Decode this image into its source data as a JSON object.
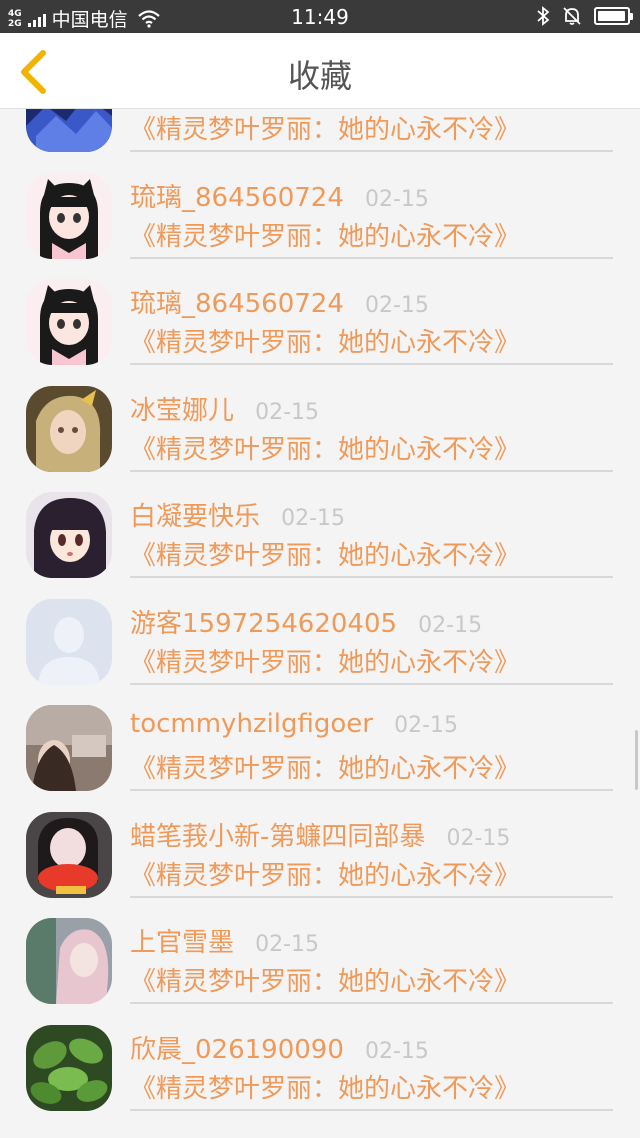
{
  "status_bar": {
    "network_top": "4G",
    "network_bottom": "2G",
    "carrier": "中国电信",
    "time": "11:49",
    "battery_level": 0.95,
    "icons": [
      "signal-icon",
      "wifi-icon",
      "bluetooth-icon",
      "silent-bell-icon",
      "battery-icon"
    ]
  },
  "header": {
    "title": "收藏",
    "back_icon": "chevron-left-icon",
    "accent_color": "#f0b400"
  },
  "colors": {
    "name": "#f09a5a",
    "date": "#c8c8c8",
    "divider": "#d8d8d8",
    "background": "#f4f4f4"
  },
  "items": [
    {
      "name": "",
      "date": "",
      "subject": "《精灵梦叶罗丽：她的心永不冷》",
      "avatar": "blue-crystal-avatar"
    },
    {
      "name": "琉璃_864560724",
      "date": "02-15",
      "subject": "《精灵梦叶罗丽：她的心永不冷》",
      "avatar": "anime-girl-cat-ears-avatar"
    },
    {
      "name": "琉璃_864560724",
      "date": "02-15",
      "subject": "《精灵梦叶罗丽：她的心永不冷》",
      "avatar": "anime-girl-cat-ears-avatar"
    },
    {
      "name": "冰莹娜儿",
      "date": "02-15",
      "subject": "《精灵梦叶罗丽：她的心永不冷》",
      "avatar": "fantasy-girl-avatar"
    },
    {
      "name": "白凝要快乐",
      "date": "02-15",
      "subject": "《精灵梦叶罗丽：她的心永不冷》",
      "avatar": "anime-girl-dark-hair-avatar"
    },
    {
      "name": "游客1597254620405",
      "date": "02-15",
      "subject": "《精灵梦叶罗丽：她的心永不冷》",
      "avatar": "default-user-avatar"
    },
    {
      "name": "tocmmyhzilgfigoer",
      "date": "02-15",
      "subject": "《精灵梦叶罗丽：她的心永不冷》",
      "avatar": "photo-avatar"
    },
    {
      "name": "蜡笔莪小新-第蠊四同部暴",
      "date": "02-15",
      "subject": "《精灵梦叶罗丽：她的心永不冷》",
      "avatar": "girl-red-scarf-avatar"
    },
    {
      "name": "上官雪墨",
      "date": "02-15",
      "subject": "《精灵梦叶罗丽：她的心永不冷》",
      "avatar": "pink-hair-girl-avatar"
    },
    {
      "name": "欣晨_026190090",
      "date": "02-15",
      "subject": "《精灵梦叶罗丽：她的心永不冷》",
      "avatar": "green-plant-avatar"
    }
  ]
}
